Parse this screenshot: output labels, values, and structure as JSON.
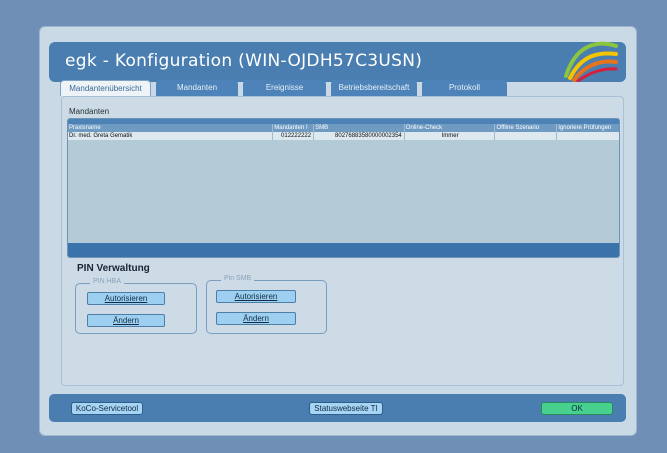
{
  "window": {
    "title": "egk - Konfiguration (WIN-OJDH57C3USN)"
  },
  "tabs": [
    {
      "label": "Mandantenübersicht",
      "active": true
    },
    {
      "label": "Mandanten",
      "active": false
    },
    {
      "label": "Ereignisse",
      "active": false
    },
    {
      "label": "Betriebsbereitschaft",
      "active": false
    },
    {
      "label": "Protokoll",
      "active": false
    }
  ],
  "mandanten": {
    "section_label": "Mandanten",
    "columns": [
      "Praxisname",
      "Mandanten I",
      "SMB",
      "Online-Check",
      "Offline Szenario",
      "Ignoriere Prüfungen"
    ],
    "rows": [
      [
        "Dr. med. Greta Gematik",
        "012222222",
        "80276883580000002354",
        "Immer",
        "",
        ""
      ]
    ]
  },
  "pin": {
    "title": "PIN Verwaltung",
    "hba": {
      "legend": "PIN HBA",
      "authorize_label": "Autorisieren",
      "change_label": "Ändern"
    },
    "smb": {
      "legend": "Pin SMB",
      "authorize_label": "Autorisieren",
      "change_label": "Ändern"
    }
  },
  "footer": {
    "servicetool_label": "KoCo-Servicetool",
    "status_label": "Statuswebseite TI",
    "ok_label": "OK"
  },
  "colors": {
    "background": "#6f8fb6",
    "titlebar": "#4a7eb0",
    "ok_button": "#47d08e",
    "button": "#9dd0f0"
  }
}
